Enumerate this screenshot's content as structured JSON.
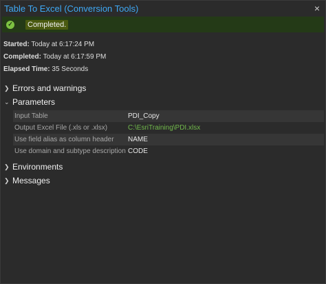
{
  "window": {
    "title": "Table To Excel (Conversion Tools)",
    "close_glyph": "×"
  },
  "status": {
    "text": "Completed."
  },
  "meta": {
    "started_label": "Started:",
    "started_value": " Today at 6:17:24 PM",
    "completed_label": "Completed:",
    "completed_value": " Today at 6:17:59 PM",
    "elapsed_label": "Elapsed Time:",
    "elapsed_value": " 35 Seconds"
  },
  "sections": {
    "errors": "Errors and warnings",
    "parameters": "Parameters",
    "environments": "Environments",
    "messages": "Messages"
  },
  "parameters": [
    {
      "key": "Input Table",
      "value": "PDI_Copy"
    },
    {
      "key": "Output Excel File (.xls or .xlsx)",
      "value": "C:\\EsriTraining\\PDI.xlsx"
    },
    {
      "key": "Use field alias as column header",
      "value": "NAME"
    },
    {
      "key": "Use domain and subtype description",
      "value": "CODE"
    }
  ]
}
